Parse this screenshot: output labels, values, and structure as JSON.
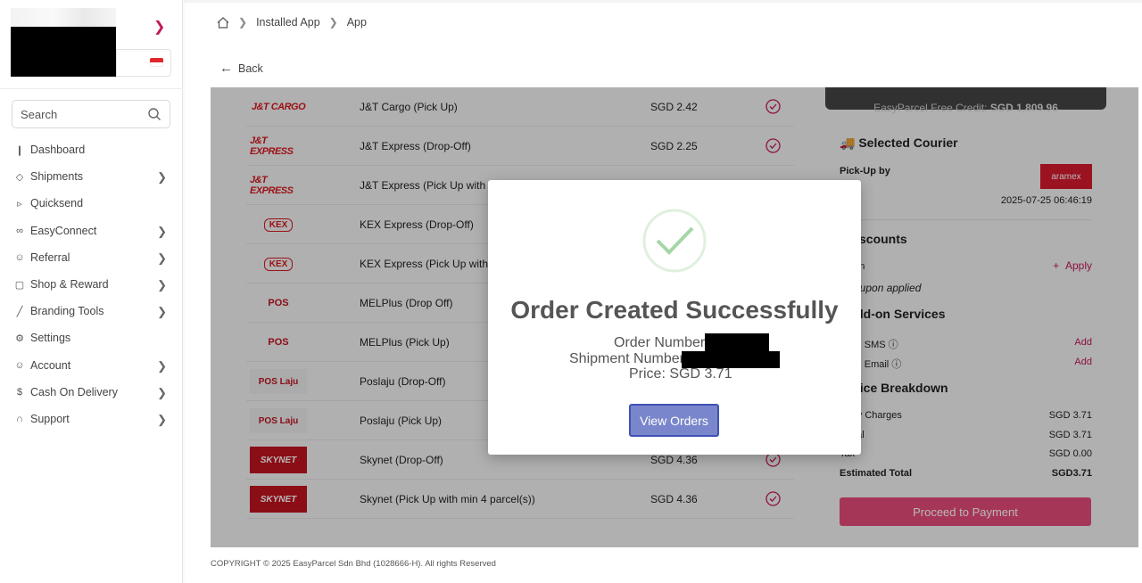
{
  "sidebar": {
    "search_placeholder": "Search",
    "items": [
      {
        "label": "Dashboard",
        "icon": "bar-chart-icon",
        "chevron": false
      },
      {
        "label": "Shipments",
        "icon": "box-icon",
        "chevron": true
      },
      {
        "label": "Quicksend",
        "icon": "send-icon",
        "chevron": false
      },
      {
        "label": "EasyConnect",
        "icon": "link-icon",
        "chevron": true
      },
      {
        "label": "Referral",
        "icon": "users-icon",
        "chevron": true
      },
      {
        "label": "Shop & Reward",
        "icon": "gift-icon",
        "chevron": true
      },
      {
        "label": "Branding Tools",
        "icon": "brush-icon",
        "chevron": true
      },
      {
        "label": "Settings",
        "icon": "gear-icon",
        "chevron": false
      },
      {
        "label": "Account",
        "icon": "user-icon",
        "chevron": true
      },
      {
        "label": "Cash On Delivery",
        "icon": "dollar-icon",
        "chevron": true
      },
      {
        "label": "Support",
        "icon": "headset-icon",
        "chevron": true
      }
    ]
  },
  "breadcrumb": {
    "items": [
      "Installed App",
      "App"
    ]
  },
  "back_label": "Back",
  "couriers": [
    {
      "name": "J&T Cargo (Pick Up)",
      "price": "SGD 2.42",
      "logo": "J&T CARGO",
      "logo_style": "jt"
    },
    {
      "name": "J&T Express (Drop-Off)",
      "price": "SGD 2.25",
      "logo": "J&T EXPRESS",
      "logo_style": "jt"
    },
    {
      "name": "J&T Express (Pick Up with mi",
      "price": "",
      "logo": "J&T EXPRESS",
      "logo_style": "jt"
    },
    {
      "name": "KEX Express (Drop-Off)",
      "price": "",
      "logo": "KEX",
      "logo_style": "kex"
    },
    {
      "name": "KEX Express (Pick Up with m",
      "price": "",
      "logo": "KEX",
      "logo_style": "kex"
    },
    {
      "name": "MELPlus (Drop Off)",
      "price": "",
      "logo": "POS",
      "logo_style": "pos"
    },
    {
      "name": "MELPlus (Pick Up)",
      "price": "",
      "logo": "POS",
      "logo_style": "pos"
    },
    {
      "name": "Poslaju (Drop-Off)",
      "price": "",
      "logo": "POS Laju",
      "logo_style": "poslaju"
    },
    {
      "name": "Poslaju (Pick Up)",
      "price": "",
      "logo": "POS Laju",
      "logo_style": "poslaju"
    },
    {
      "name": "Skynet (Drop-Off)",
      "price": "SGD 4.36",
      "logo": "SKYNET",
      "logo_style": "skynet"
    },
    {
      "name": "Skynet (Pick Up with min 4 parcel(s))",
      "price": "SGD 4.36",
      "logo": "SKYNET",
      "logo_style": "skynet"
    }
  ],
  "right_panel": {
    "credit_label": "EasyParcel Free Credit:",
    "credit_value": "SGD 1,809.96",
    "selected_courier_title": "Selected Courier",
    "pickup_label": "Pick-Up by",
    "pickup_datetime": "2025-07-25 06:46:19",
    "courier_logo": "aramex",
    "discounts_title": "Discounts",
    "coupon_label": "pon",
    "apply_label": "Apply",
    "no_coupon": "coupon applied",
    "addon_title": "Add-on Services",
    "addon_sms": "ing SMS",
    "addon_email": "ing Email",
    "add_label": "Add",
    "price_title": "Price Breakdown",
    "delivery_label": "ery Charges",
    "delivery_value": "SGD 3.71",
    "subtotal_label": "otal",
    "subtotal_value": "SGD 3.71",
    "tax_label": "Tax",
    "tax_value": "SGD 0.00",
    "estimated_label": "Estimated Total",
    "estimated_value": "SGD3.71",
    "pay_button": "Proceed to Payment"
  },
  "modal": {
    "title": "Order Created Successfully",
    "order_label": "Order Number:",
    "shipment_label": "Shipment Number:",
    "price_label": "Price: SGD 3.71",
    "button": "View Orders"
  },
  "footer": "COPYRIGHT © 2025 EasyParcel Sdn Bhd (1028666-H). All rights Reserved",
  "colors": {
    "accent": "#c2185b",
    "pay_button": "#e74b7a",
    "modal_button": "#7986cb",
    "check": "#a5d6a7"
  }
}
